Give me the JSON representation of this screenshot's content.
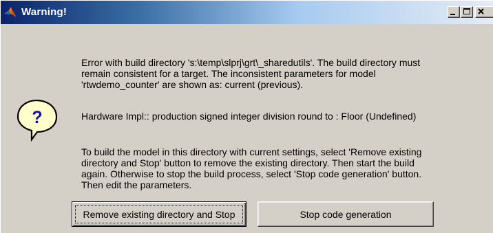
{
  "window": {
    "title": "Warning!",
    "app_icon": "matlab-icon",
    "controls": {
      "minimize_icon": "minimize-icon",
      "maximize_icon": "maximize-icon",
      "close_icon": "close-icon"
    }
  },
  "dialog": {
    "icon": "question-icon",
    "paragraphs": [
      "Error with build directory 's:\\temp\\slprj\\grt\\_sharedutils'. The build directory must remain consistent for a target. The inconsistent parameters for model 'rtwdemo_counter' are shown as: current (previous).",
      "Hardware  Impl:: production signed integer division round to : Floor (Undefined)",
      "To build the model in this directory with current settings, select 'Remove existing directory and Stop' button to remove the existing directory. Then start the build again. Otherwise to stop the build process, select 'Stop code generation' button. Then edit the parameters."
    ],
    "buttons": {
      "remove": "Remove existing directory and Stop",
      "stop": "Stop code generation"
    }
  },
  "colors": {
    "title_bar_start": "#0a246a",
    "title_bar_end": "#e6ecf3",
    "dialog_bg": "#d4d0c8",
    "icon_fill": "#ffffcc"
  }
}
